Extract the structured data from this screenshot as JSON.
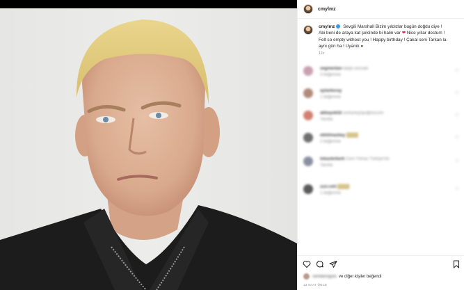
{
  "post": {
    "username": "cmylmz",
    "caption_line1": "Sevgili Marshall Bizim yıldızlar bugün doğdu diye !",
    "caption_line2": "Abi beni de araya kat şeklinde bi halin var",
    "caption_line2b": "Nice yıllar dostum !",
    "caption_line3": "Felt so empty without you ! Happy birthday ! Çakal seni Tarkan la",
    "caption_line4": "aynı gün ha ! Uyanık",
    "caption_time": "12s",
    "likes_prefix_blurred": "ramdanogulu",
    "likes_text": "ve diğer kişiler beğendi",
    "time_ago": "13 SAAT ÖNCE"
  },
  "comments": [
    {
      "name": "segmentan",
      "text": "ladyk.cenzaki",
      "meta": "3 beğenme",
      "color": "#c9a0b0"
    },
    {
      "name": "aylankoray",
      "text": "",
      "meta": "1 beğenme",
      "color": "#b08a7a"
    },
    {
      "name": "akbaşoklüt",
      "text": "serkaneyüpoğlulucom",
      "meta": "Yanıtla",
      "color": "#d08070"
    },
    {
      "name": "ebtülmazbay",
      "text": "",
      "meta": "2 beğenme",
      "color": "#6f6f6f"
    },
    {
      "name": "lokaxlerberk",
      "text": "Cem Yılmaz Türkiye'nin",
      "meta": "Yanıtla",
      "color": "#8a8fa0"
    },
    {
      "name": "zzzi.ruhi",
      "text": "",
      "meta": "1 beğenme",
      "color": "#5a5a5a"
    }
  ],
  "icons": {
    "like": "heart-outline-icon",
    "comment": "speech-bubble-icon",
    "share": "paper-plane-icon",
    "save": "bookmark-icon"
  },
  "colors": {
    "verified": "#3897f0",
    "heart": "#e0245e"
  }
}
